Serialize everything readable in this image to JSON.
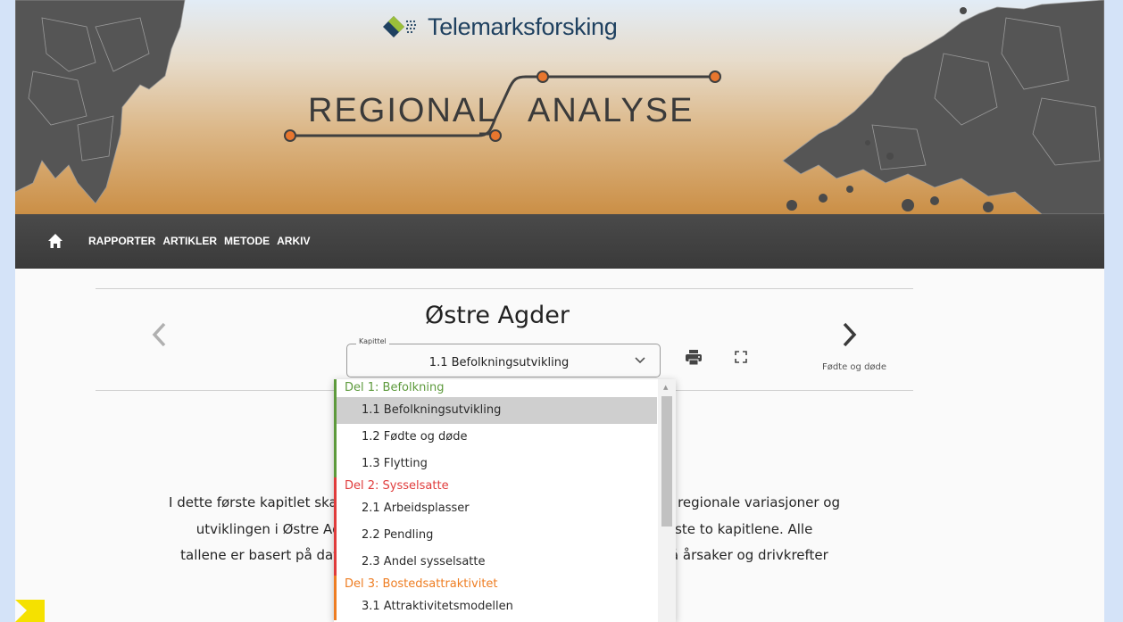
{
  "brand": {
    "name": "Telemarksforsking"
  },
  "hero": {
    "word_left": "REGIONAL",
    "word_right": "ANALYSE"
  },
  "nav": {
    "links": [
      "RAPPORTER",
      "ARTIKLER",
      "METODE",
      "ARKIV"
    ]
  },
  "page": {
    "title": "Østre Agder"
  },
  "chapter_select": {
    "legend": "Kapittel",
    "value": "1.1 Befolkningsutvikling"
  },
  "next": {
    "label": "Fødte og døde"
  },
  "dropdown": {
    "groups": [
      {
        "label": "Del 1: Befolkning",
        "color": "#5d9a3c",
        "items": [
          "1.1 Befolkningsutvikling",
          "1.2 Fødte og døde",
          "1.3 Flytting"
        ]
      },
      {
        "label": "Del 2: Sysselsatte",
        "color": "#e03c3c",
        "items": [
          "2.1 Arbeidsplasser",
          "2.2 Pendling",
          "2.3 Andel sysselsatte"
        ]
      },
      {
        "label": "Del 3: Bostedsattraktivitet",
        "color": "#ee7d22",
        "items": [
          "3.1 Attraktivitetsmodellen"
        ]
      }
    ],
    "selected": "1.1 Befolkningsutvikling"
  },
  "intro": {
    "lines": [
      "I dette første kapitlet skal vi be                                                           Norge, regionale variasjoner og",
      "utviklingen i Østre Agder, fø                                                        tting neste to kapitlene. Alle",
      "tallene er basert på data fra be                                                       å inn på årsaker og drivkrefter",
      "til befol                                                 ktivitet."
    ]
  },
  "colors": {
    "accent": "#e8762e",
    "nav_bg": "#3e3e3e",
    "brand_text": "#1f4160"
  },
  "icons": [
    "home-icon",
    "chevron-left-icon",
    "chevron-right-icon",
    "print-icon",
    "fullscreen-icon",
    "chevron-down-icon"
  ]
}
